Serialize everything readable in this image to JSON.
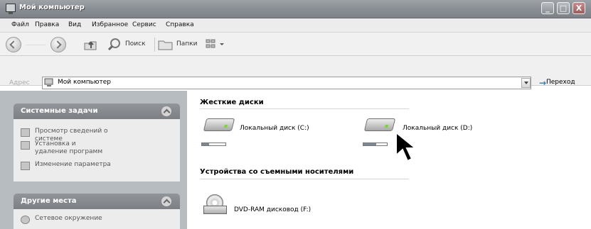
{
  "window": {
    "title": "Мой компьютер",
    "buttons": [
      "_",
      "□",
      "X"
    ]
  },
  "menu": [
    "Файл",
    "Правка",
    "Вид",
    "Избранное",
    "Сервис",
    "Справка"
  ],
  "toolbar": {
    "search_label": "Поиск",
    "folders_label": "Папки"
  },
  "address": {
    "label": "Адрес",
    "value": "Мой компьютер",
    "go_label": "Переход"
  },
  "left_panel": {
    "system_tasks": {
      "title": "Системные задачи",
      "items": [
        {
          "label": "Просмотр сведений о системе",
          "icon": "system-info-icon"
        },
        {
          "label": "Установка и удаление программ",
          "icon": "add-remove-programs-icon"
        },
        {
          "label": "Изменение параметра",
          "icon": "change-setting-icon"
        }
      ]
    },
    "other_places": {
      "title": "Другие места",
      "items": [
        {
          "label": "Сетевое окружение",
          "icon": "network-places-icon"
        }
      ]
    }
  },
  "content": {
    "hard_drives_title": "Жесткие диски",
    "removable_title": "Устройства со съемными носителями",
    "drives": [
      {
        "label": "Локальный диск (C:)",
        "used_fraction": 0.3
      },
      {
        "label": "Локальный диск (D:)",
        "used_fraction": 0.55
      }
    ],
    "removable": [
      {
        "label": "DVD-RAM дисковод (F:)",
        "icon": "dvd-drive-icon"
      }
    ]
  },
  "icons": {
    "title": "my-computer-icon",
    "back": "back-arrow-icon",
    "forward": "forward-arrow-icon",
    "up": "up-folder-icon",
    "search": "search-icon",
    "folders": "folders-icon",
    "views": "views-icon",
    "address": "computer-icon",
    "go": "go-arrow-icon",
    "drive": "hard-drive-icon",
    "cursor": "mouse-pointer-icon"
  }
}
